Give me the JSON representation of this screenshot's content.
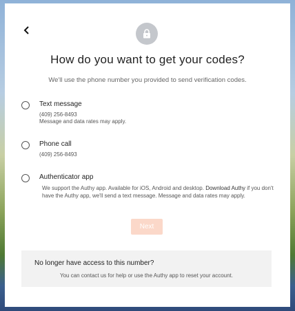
{
  "header": {
    "back_icon": "chevron-left-icon",
    "lock_icon": "lock-icon",
    "title": "How do you want to get your codes?",
    "subtitle": "We'll use the phone number you provided to send verification codes."
  },
  "options": [
    {
      "label": "Text message",
      "phone": "(409) 256-8493",
      "note": "Message and data rates may apply."
    },
    {
      "label": "Phone call",
      "phone": "(409) 256-8493"
    },
    {
      "label": "Authenticator app",
      "desc_before": "We support the Authy app. Available for iOS, Android and desktop. ",
      "desc_link": "Download Authy",
      "desc_after": " if you don't have the Authy app, we'll send a text message. Message and data rates may apply."
    }
  ],
  "next_button": {
    "label": "Next",
    "disabled": true,
    "color": "#fbd8c9"
  },
  "help_box": {
    "title": "No longer have access to this number?",
    "text_before": "You can contact us for help or use the ",
    "text_link": "Authy app",
    "text_after": " to reset your account."
  },
  "colors": {
    "card_bg": "#ffffff",
    "lock_circle": "#c4c7cc",
    "help_bg": "#f2f2f2"
  }
}
